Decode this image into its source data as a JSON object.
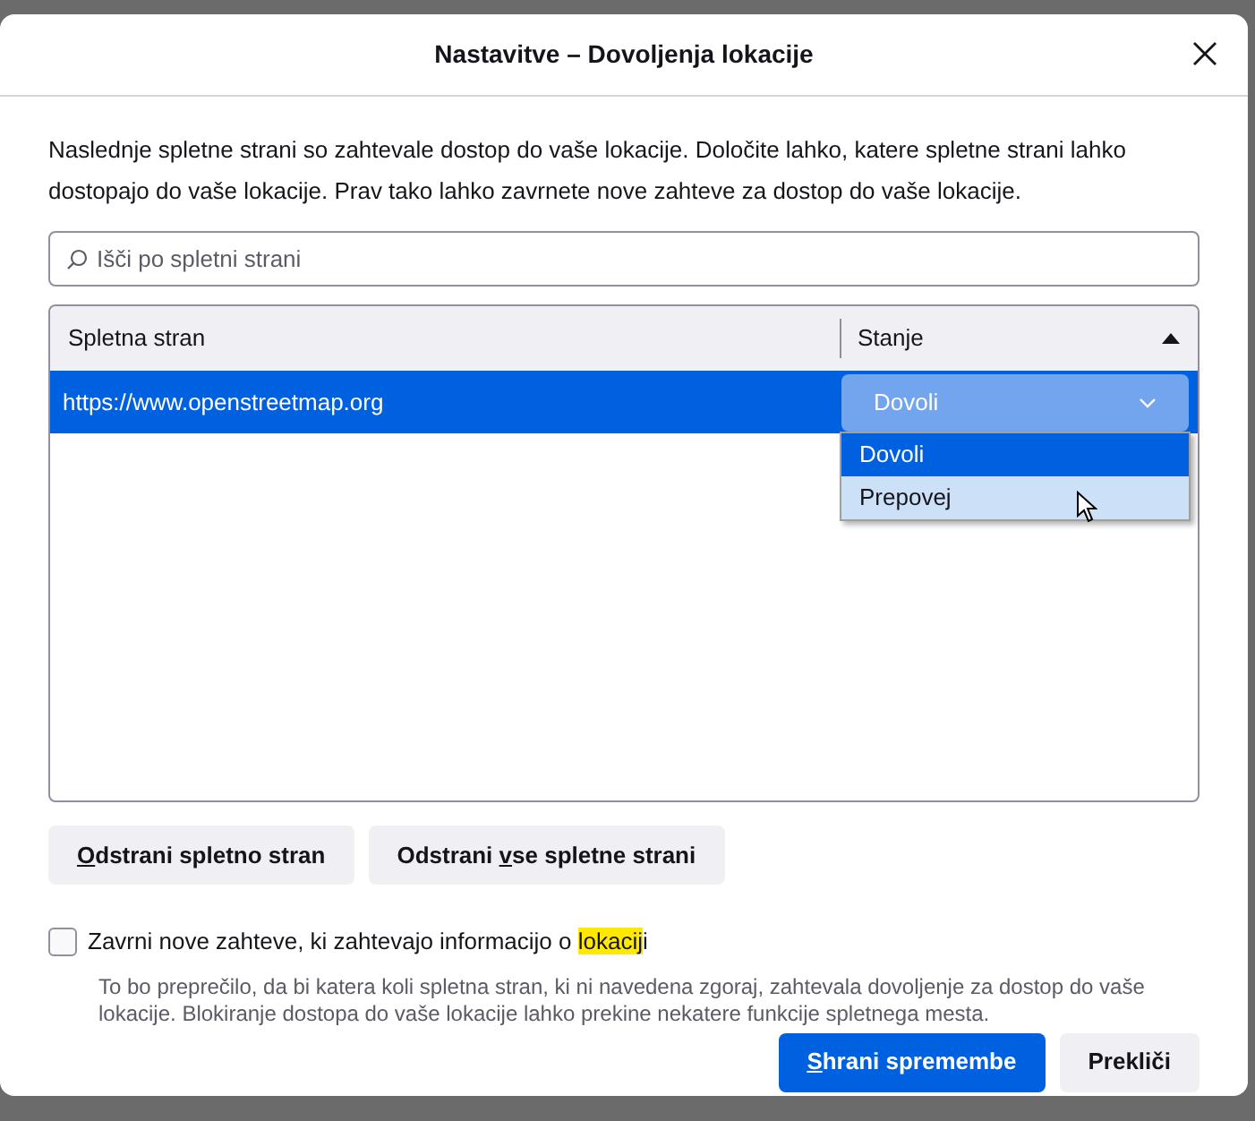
{
  "dialog": {
    "title": "Nastavitve – Dovoljenja lokacije",
    "intro": "Naslednje spletne strani so zahtevale dostop do vaše lokacije. Določite lahko, katere spletne strani lahko dostopajo do vaše lokacije. Prav tako lahko zavrnete nove zahteve za dostop do vaše lokacije."
  },
  "search": {
    "placeholder": "Išči po spletni strani"
  },
  "table": {
    "columns": [
      {
        "label": "Spletna stran",
        "sorted": false
      },
      {
        "label": "Stanje",
        "sorted": true
      }
    ],
    "rows": [
      {
        "site": "https://www.openstreetmap.org",
        "status": "Dovoli",
        "selected": true
      }
    ]
  },
  "status_dropdown": {
    "expanded": true,
    "options": [
      {
        "label": "Dovoli",
        "selected": true,
        "hovered": false
      },
      {
        "label": "Prepovej",
        "selected": false,
        "hovered": true
      }
    ]
  },
  "remove_buttons": [
    {
      "label_parts": [
        {
          "text": "O",
          "underlined": true
        },
        {
          "text": "dstrani spletno stran",
          "underlined": false
        }
      ]
    },
    {
      "label_parts": [
        {
          "text": "Odstrani ",
          "underlined": false
        },
        {
          "text": "v",
          "underlined": true
        },
        {
          "text": "se spletne strani",
          "underlined": false
        }
      ]
    }
  ],
  "block_option": {
    "label_parts": [
      {
        "text": "Zavrni nove zahteve, ki zahtevajo informacijo o ",
        "highlighted": false
      },
      {
        "text": "lokacij",
        "highlighted": true
      },
      {
        "text": "i",
        "highlighted": false
      }
    ],
    "checked": false,
    "description": "To bo preprečilo, da bi katera koli spletna stran, ki ni navedena zgoraj, zahtevala dovoljenje za dostop do vaše lokacije. Blokiranje dostopa do vaše lokacije lahko prekine nekatere funkcije spletnega mesta."
  },
  "footer_buttons": [
    {
      "label_parts": [
        {
          "text": "S",
          "underlined": true
        },
        {
          "text": "hrani spremembe",
          "underlined": false
        }
      ],
      "kind": "primary"
    },
    {
      "label_parts": [
        {
          "text": "Prekliči",
          "underlined": false
        }
      ],
      "kind": "secondary"
    }
  ]
}
